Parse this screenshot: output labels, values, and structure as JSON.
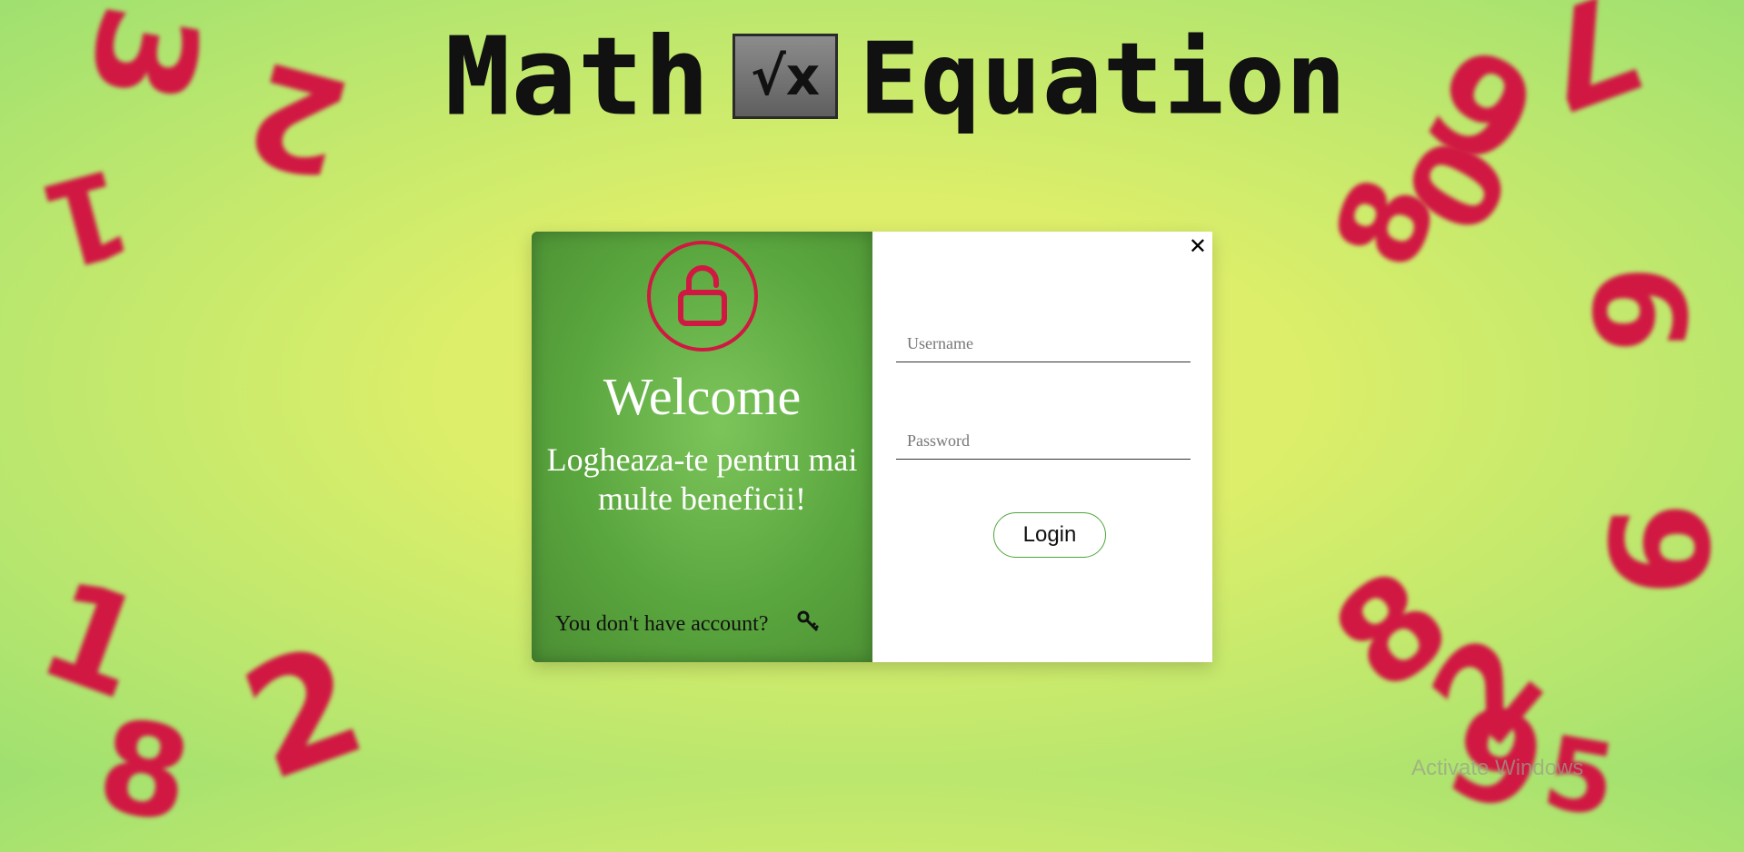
{
  "header": {
    "logo_word_1": "Math",
    "logo_badge": "√x",
    "logo_word_2": "Equation"
  },
  "background": {
    "digits": [
      "3",
      "2",
      "1",
      "1",
      "2",
      "8",
      "8",
      "7",
      "6",
      "0",
      "9",
      "8",
      "9",
      "2",
      "6",
      "5",
      "9",
      "7"
    ],
    "digit_color": "#d01842"
  },
  "modal": {
    "left": {
      "lock_icon": "unlocked-padlock",
      "welcome": "Welcome",
      "subtitle": "Logheaza-te pentru mai multe beneficii!",
      "no_account_text": "You don't have account?",
      "key_icon": "key"
    },
    "right": {
      "close_icon": "close-x",
      "username_placeholder": "Username",
      "password_placeholder": "Password",
      "login_label": "Login"
    }
  },
  "os": {
    "watermark": "Activate Windows"
  },
  "colors": {
    "accent_red": "#d01842",
    "panel_green": "#5aa63e",
    "button_border": "#4fa53a"
  }
}
